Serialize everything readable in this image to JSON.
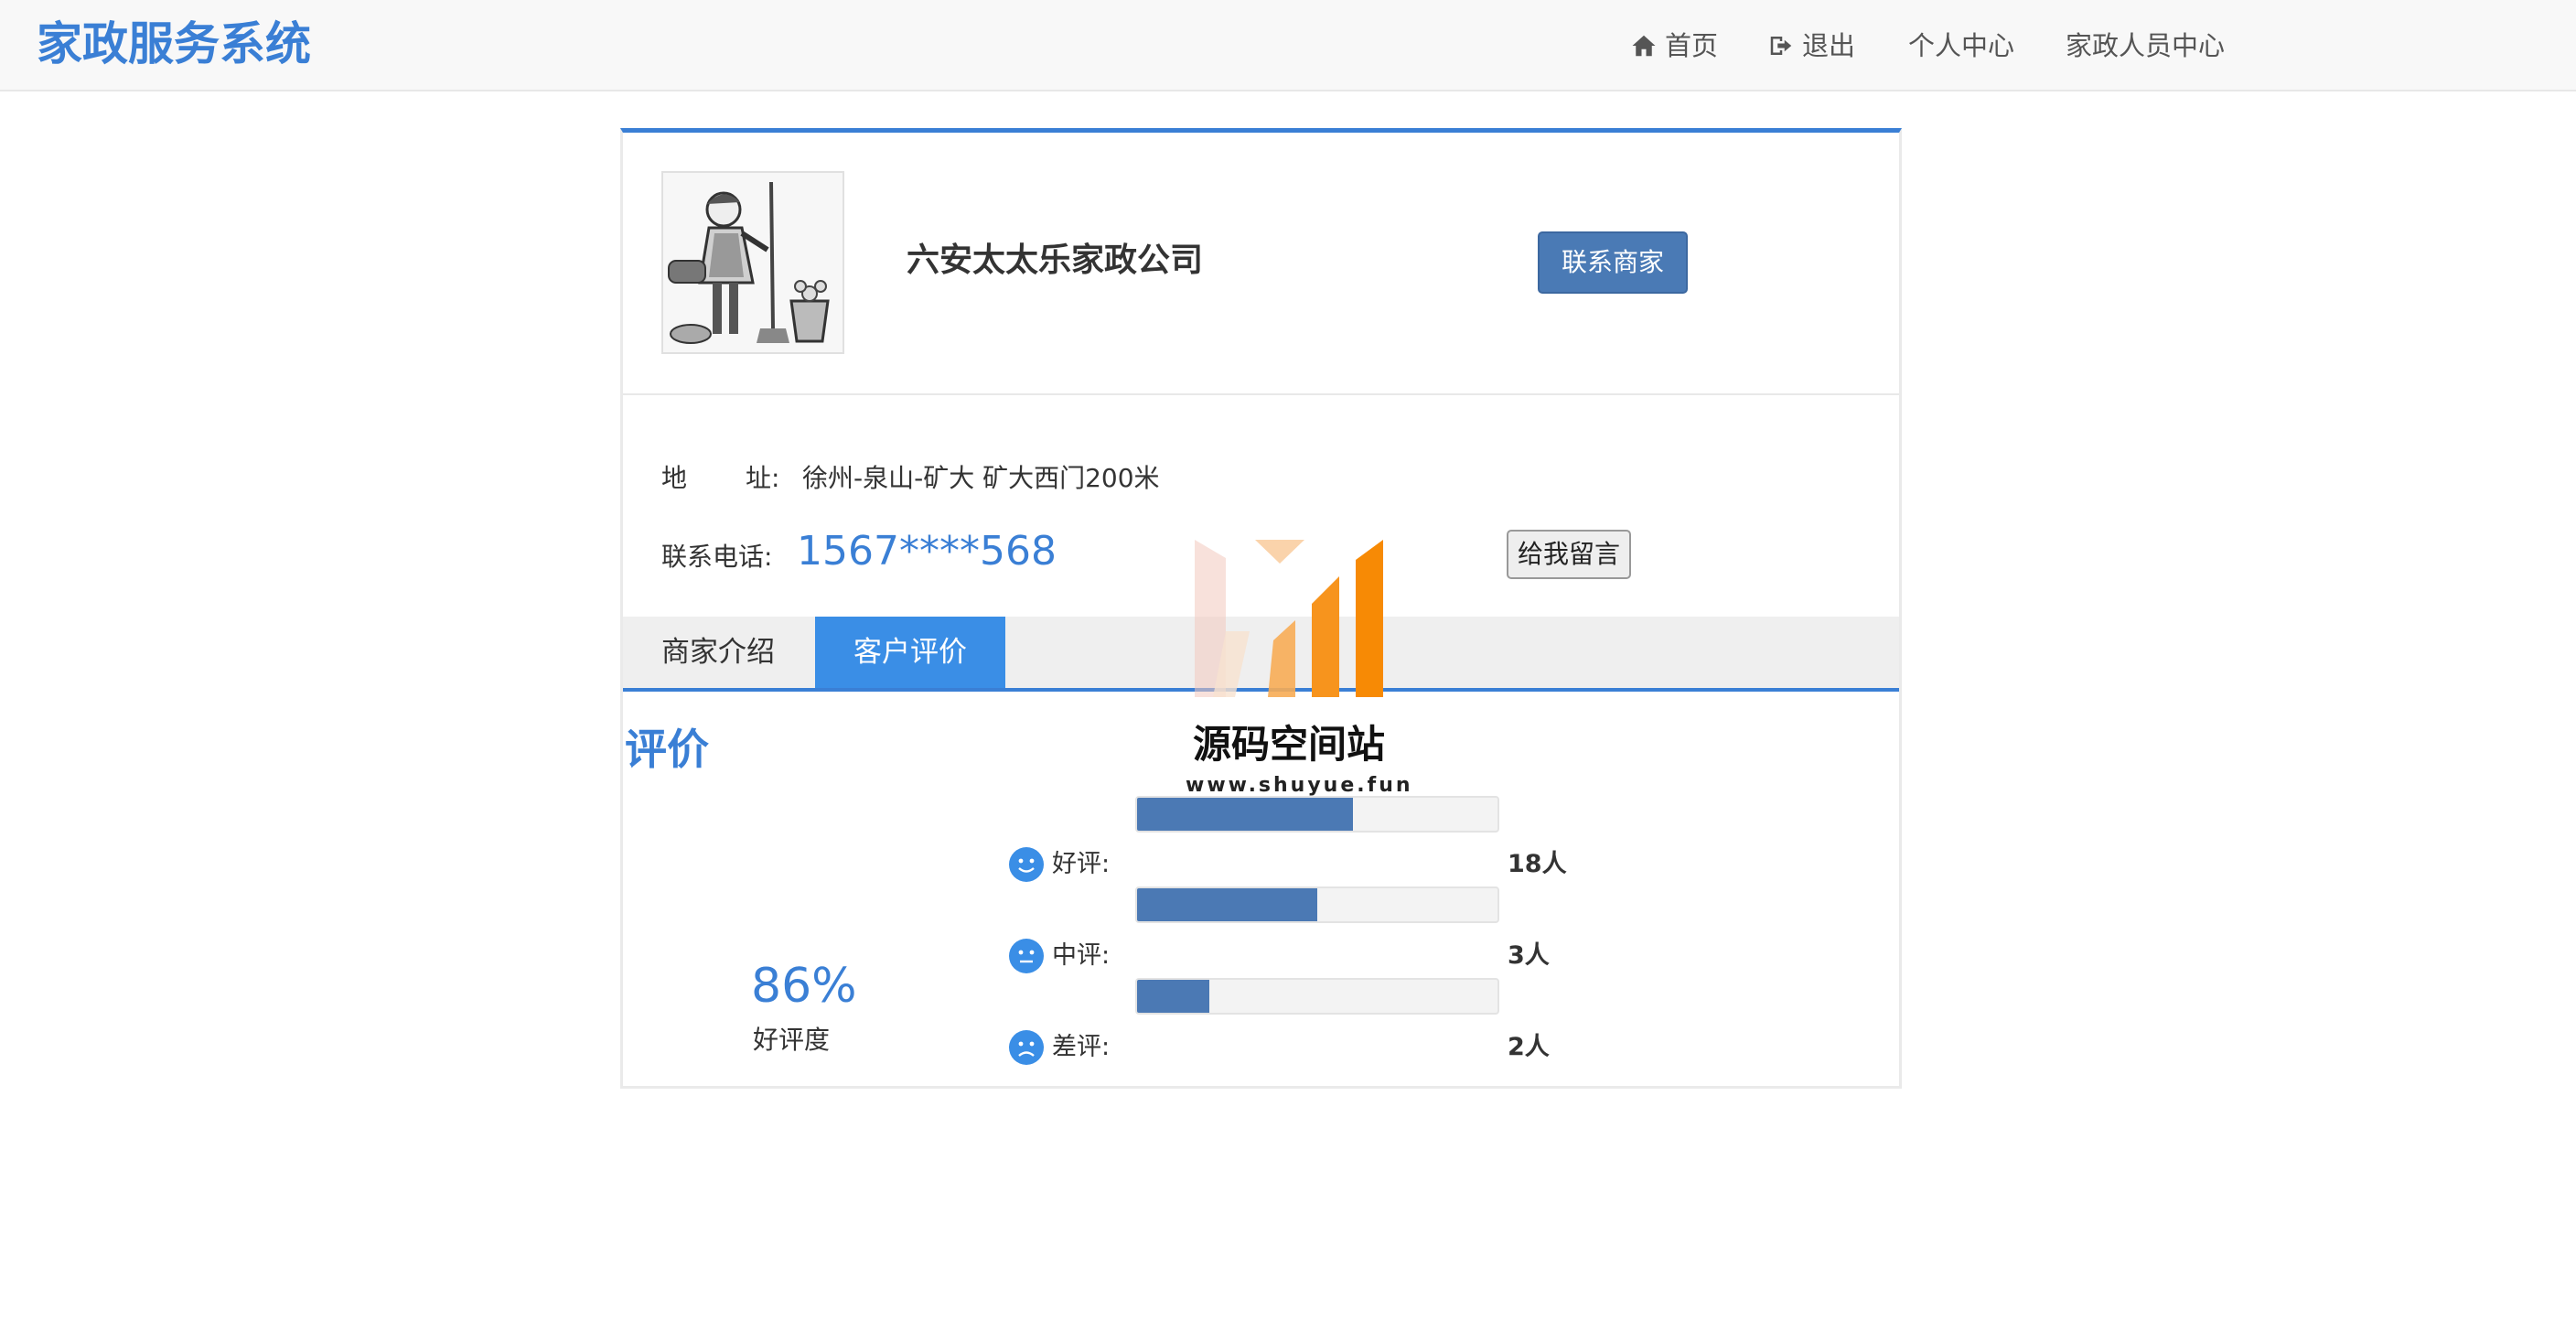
{
  "app": {
    "brand": "家政服务系统"
  },
  "nav": {
    "home": "首页",
    "logout": "退出",
    "profile": "个人中心",
    "staff_center": "家政人员中心"
  },
  "merchant": {
    "name": "六安太太乐家政公司",
    "contact_button": "联系商家",
    "address_label_1": "地",
    "address_label_2": "址:",
    "address": "徐州-泉山-矿大 矿大西门200米",
    "phone_label": "联系电话:",
    "phone": "1567****568",
    "message_button": "给我留言"
  },
  "tabs": [
    {
      "label": "商家介绍",
      "active": false
    },
    {
      "label": "客户评价",
      "active": true
    }
  ],
  "reviews": {
    "title": "评价",
    "positive_rate": "86%",
    "positive_rate_label": "好评度",
    "rows": [
      {
        "label": "好评:",
        "count": "18人",
        "fill": 0.6,
        "icon": "smile-icon"
      },
      {
        "label": "中评:",
        "count": "3人",
        "fill": 0.5,
        "icon": "neutral-face-icon"
      },
      {
        "label": "差评:",
        "count": "2人",
        "fill": 0.2,
        "icon": "frown-icon"
      }
    ]
  },
  "watermark": {
    "title": "源码空间站",
    "url": "www.shuyue.fun"
  },
  "colors": {
    "accent": "#3a7fd5",
    "button": "#4a7ab5",
    "tab_active": "#3a8ee6",
    "bar_fill": "#4b79b4",
    "watermark_orange": "#f7941d"
  }
}
